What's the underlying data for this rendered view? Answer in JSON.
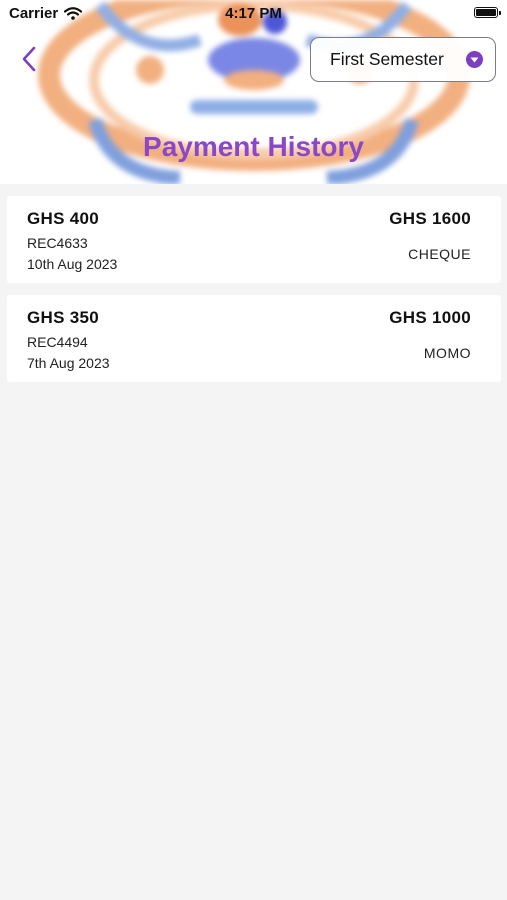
{
  "status_bar": {
    "carrier": "Carrier",
    "time": "4:17 PM"
  },
  "header": {
    "title": "Payment History",
    "semester_select": {
      "selected": "First Semester"
    }
  },
  "payments": [
    {
      "amount": "GHS 400",
      "receipt": "REC4633",
      "date": "10th Aug 2023",
      "total": "GHS 1600",
      "method": "CHEQUE"
    },
    {
      "amount": "GHS 350",
      "receipt": "REC4494",
      "date": "7th Aug 2023",
      "total": "GHS 1000",
      "method": "MOMO"
    }
  ],
  "colors": {
    "accent": "#8a47c8",
    "background": "#f4f4f4",
    "card": "#ffffff"
  },
  "icons": {
    "back": "chevron-left-icon",
    "dropdown": "chevron-down-circle-icon",
    "wifi": "wifi-icon",
    "battery": "battery-icon"
  }
}
